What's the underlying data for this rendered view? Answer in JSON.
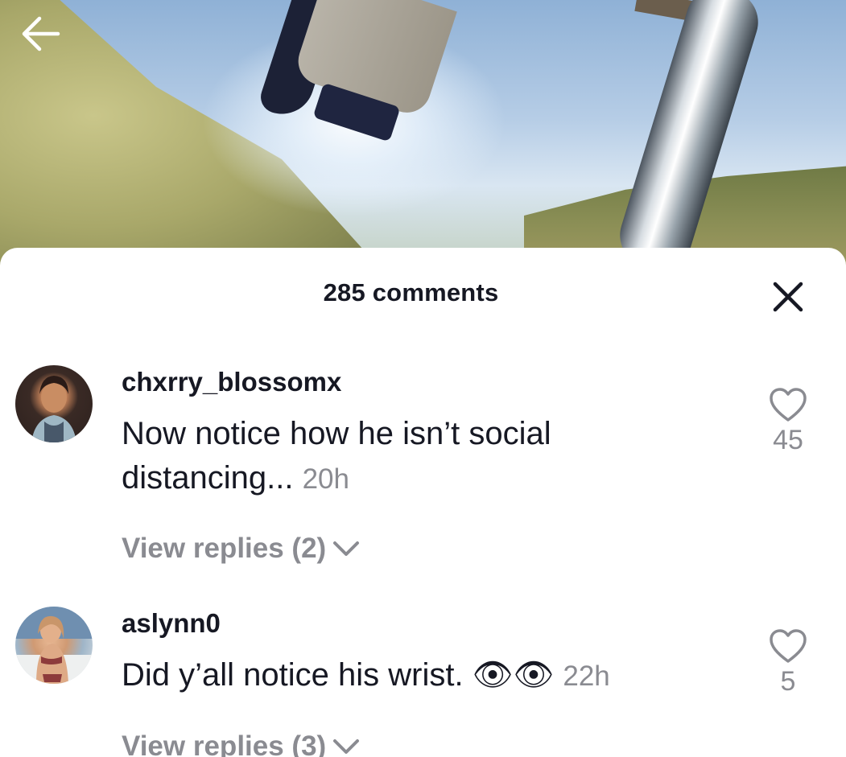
{
  "header": {
    "comments_title": "285 comments"
  },
  "comments": [
    {
      "username": "chxrry_blossomx",
      "text": "Now notice how he isn’t social distancing...",
      "time": "20h",
      "likes": "45",
      "replies_label": "View replies (2)"
    },
    {
      "username": "aslynn0",
      "text": "Did y’all notice his wrist. 👁👁",
      "time": "22h",
      "likes": "5",
      "replies_label": "View replies (3)"
    }
  ],
  "icons": {
    "back": "arrow-left-icon",
    "close": "close-icon",
    "like": "heart-outline-icon",
    "expand": "chevron-down-icon"
  },
  "colors": {
    "primary_text": "#161823",
    "secondary_text": "#8a8b91",
    "sheet_background": "#ffffff"
  }
}
